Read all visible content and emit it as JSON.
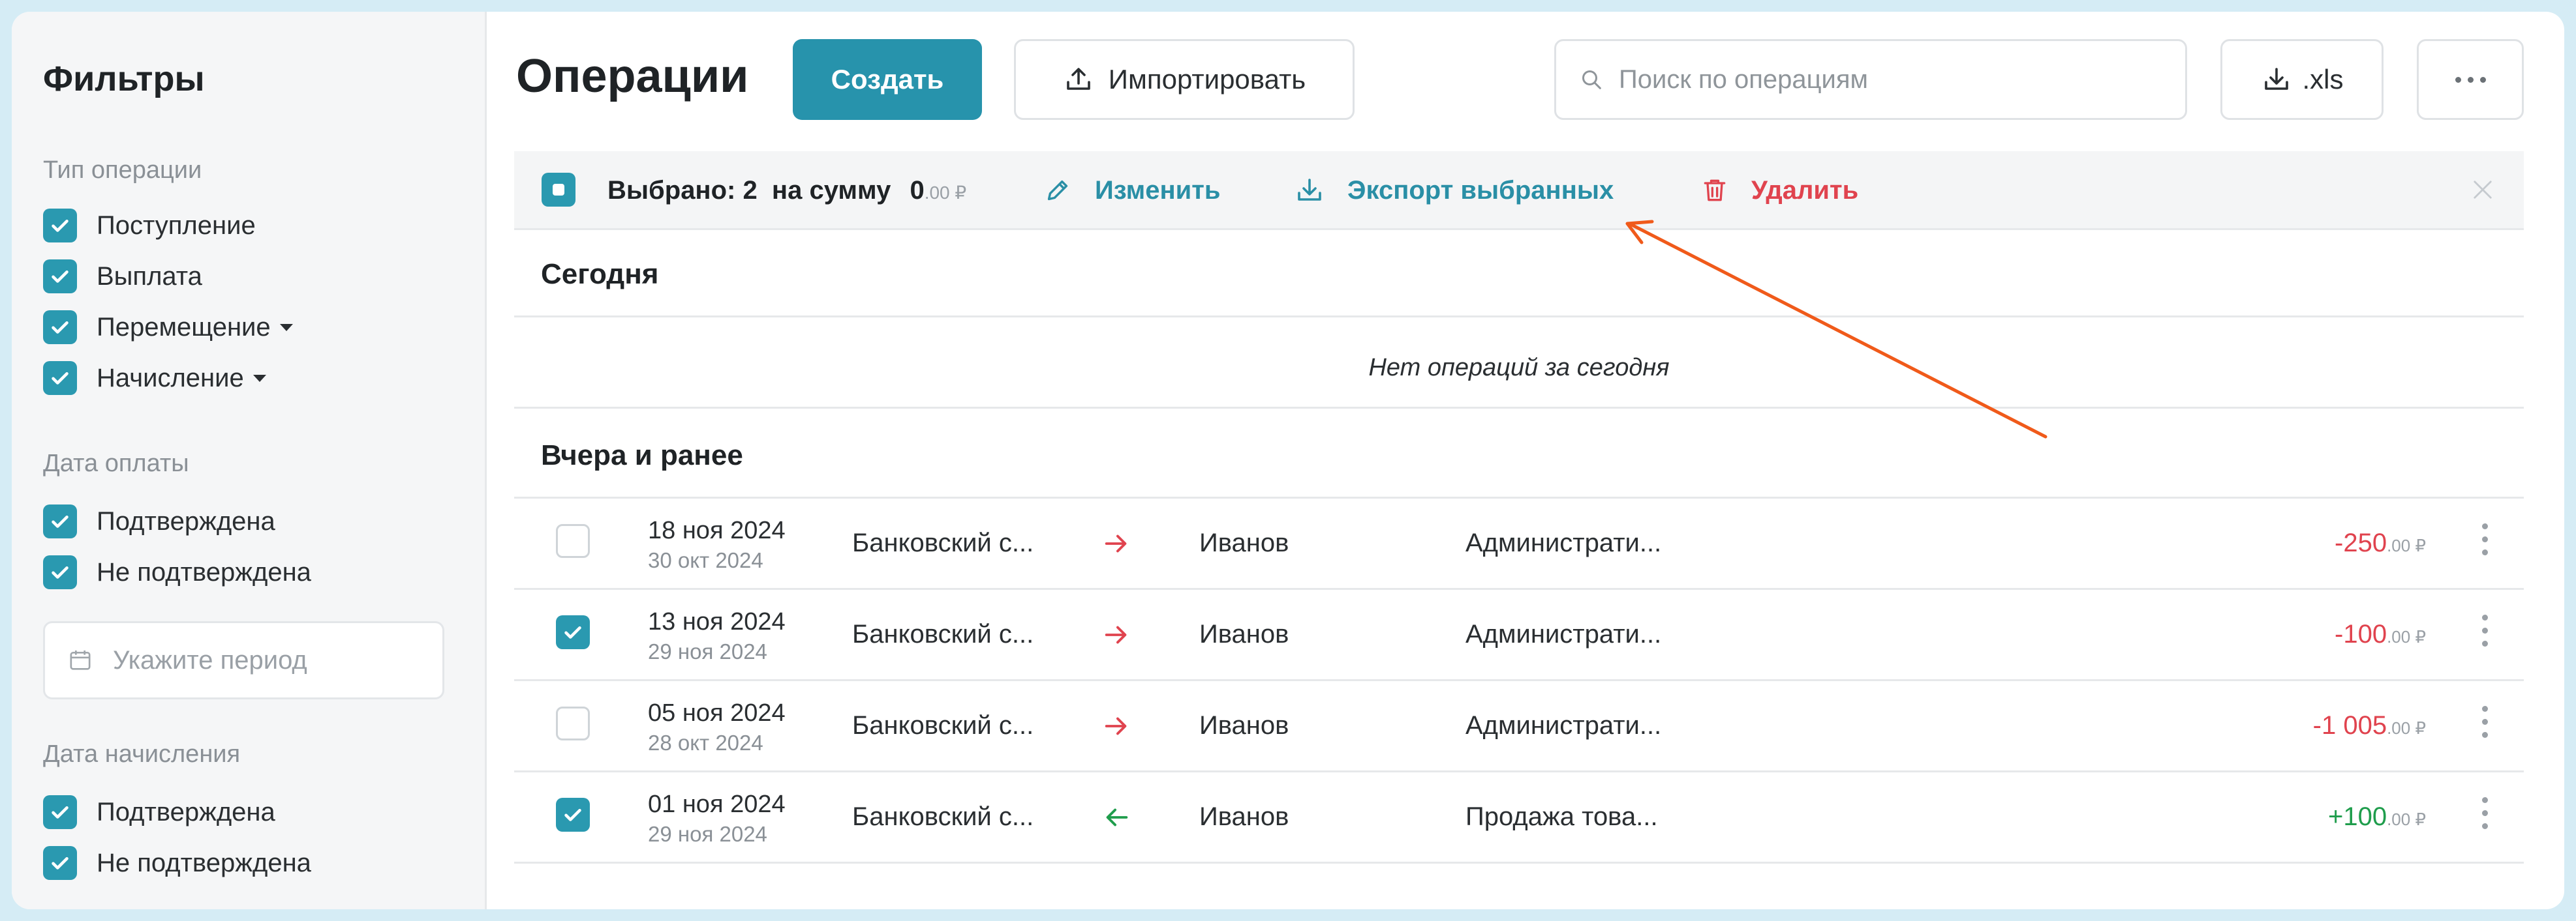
{
  "sidebar": {
    "title": "Фильтры",
    "operation_type": {
      "title": "Тип операции",
      "items": [
        {
          "label": "Поступление",
          "checked": true,
          "dropdown": false
        },
        {
          "label": "Выплата",
          "checked": true,
          "dropdown": false
        },
        {
          "label": "Перемещение",
          "checked": true,
          "dropdown": true
        },
        {
          "label": "Начисление",
          "checked": true,
          "dropdown": true
        }
      ]
    },
    "payment_date": {
      "title": "Дата оплаты",
      "items": [
        {
          "label": "Подтверждена",
          "checked": true
        },
        {
          "label": "Не подтверждена",
          "checked": true
        }
      ],
      "period_placeholder": "Укажите период"
    },
    "accrual_date": {
      "title": "Дата начисления",
      "items": [
        {
          "label": "Подтверждена",
          "checked": true
        },
        {
          "label": "Не подтверждена",
          "checked": true
        }
      ]
    }
  },
  "header": {
    "title": "Операции",
    "create_label": "Создать",
    "import_label": "Импортировать",
    "search_placeholder": "Поиск по операциям",
    "xls_label": ".xls",
    "more_icon": "more-horizontal-icon"
  },
  "selection": {
    "text": "Выбрано: 2  на сумму",
    "amount_int": "0",
    "amount_frac": ".00 ₽",
    "edit_label": "Изменить",
    "export_label": "Экспорт выбранных",
    "delete_label": "Удалить"
  },
  "sections": {
    "today": {
      "title": "Сегодня",
      "empty": "Нет операций за сегодня"
    },
    "earlier": {
      "title": "Вчера и ранее"
    }
  },
  "operations": [
    {
      "checked": false,
      "date": "18 ноя 2024",
      "date_sub": "30 окт 2024",
      "account": "Банковский с...",
      "direction": "out",
      "person": "Иванов",
      "category": "Администрати...",
      "amount_int": "-250",
      "amount_frac": ".00 ₽"
    },
    {
      "checked": true,
      "date": "13 ноя 2024",
      "date_sub": "29 ноя 2024",
      "account": "Банковский с...",
      "direction": "out",
      "person": "Иванов",
      "category": "Администрати...",
      "amount_int": "-100",
      "amount_frac": ".00 ₽"
    },
    {
      "checked": false,
      "date": "05 ноя 2024",
      "date_sub": "28 окт 2024",
      "account": "Банковский с...",
      "direction": "out",
      "person": "Иванов",
      "category": "Администрати...",
      "amount_int": "-1 005",
      "amount_frac": ".00 ₽"
    },
    {
      "checked": true,
      "date": "01 ноя 2024",
      "date_sub": "29 ноя 2024",
      "account": "Банковский с...",
      "direction": "in",
      "person": "Иванов",
      "category": "Продажа това...",
      "amount_int": "+100",
      "amount_frac": ".00 ₽"
    }
  ],
  "colors": {
    "accent": "#2793ac",
    "checkbox": "#2a99b0",
    "negative": "#e0434e",
    "positive": "#1f9d4c",
    "annotation_arrow": "#f05a1a"
  }
}
